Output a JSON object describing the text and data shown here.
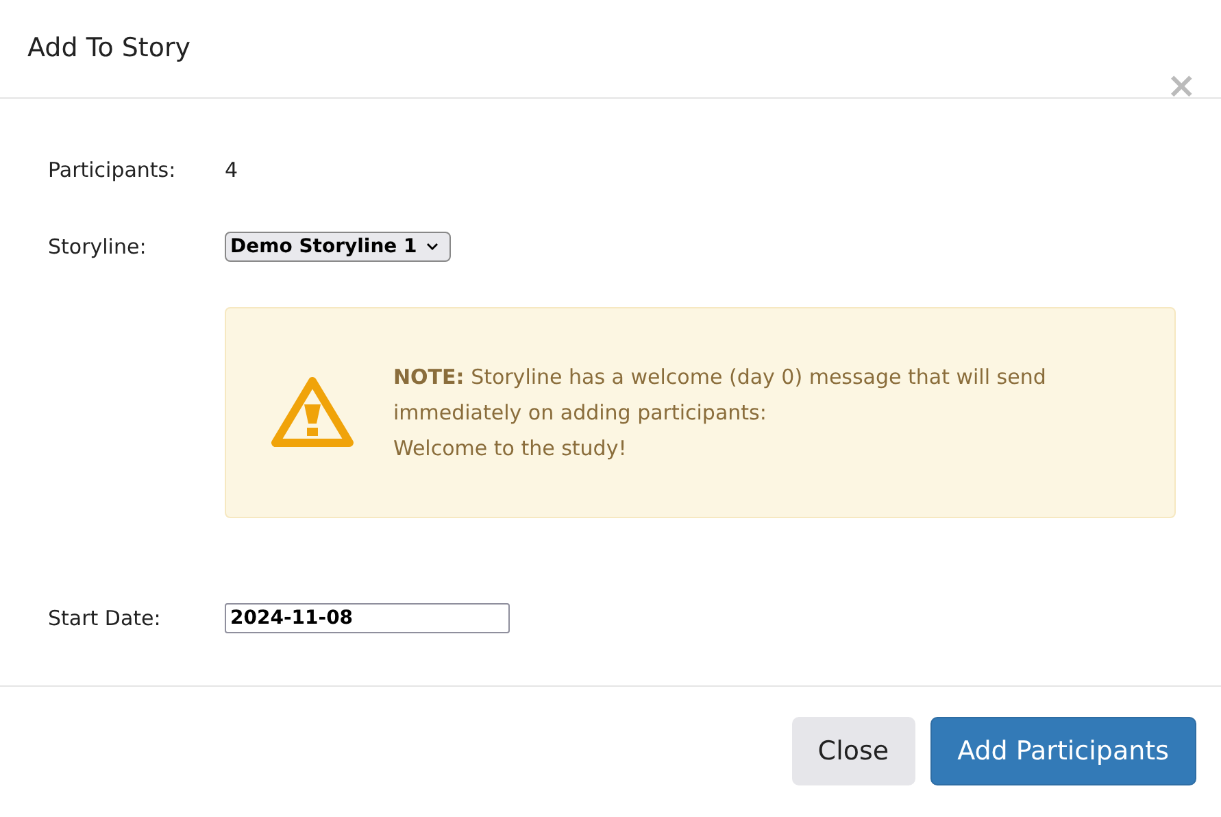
{
  "dialog": {
    "title": "Add To Story",
    "close_glyph": "×"
  },
  "fields": [
    {
      "kind": "text",
      "label": "Participants:",
      "value": "4"
    },
    {
      "kind": "select",
      "label": "Storyline:",
      "value": "Demo Storyline 1"
    }
  ],
  "alert": {
    "note": "**NOTE:** Storyline has a welcome (day 0) message that will send immediately on adding participants:",
    "message": "Welcome to the study!"
  },
  "start_date": {
    "label": "Start Date:",
    "value": "2024-11-08"
  },
  "buttons": [
    {
      "label": "Close",
      "kind": "secondary"
    },
    {
      "label": "Add Participants",
      "kind": "primary"
    }
  ]
}
